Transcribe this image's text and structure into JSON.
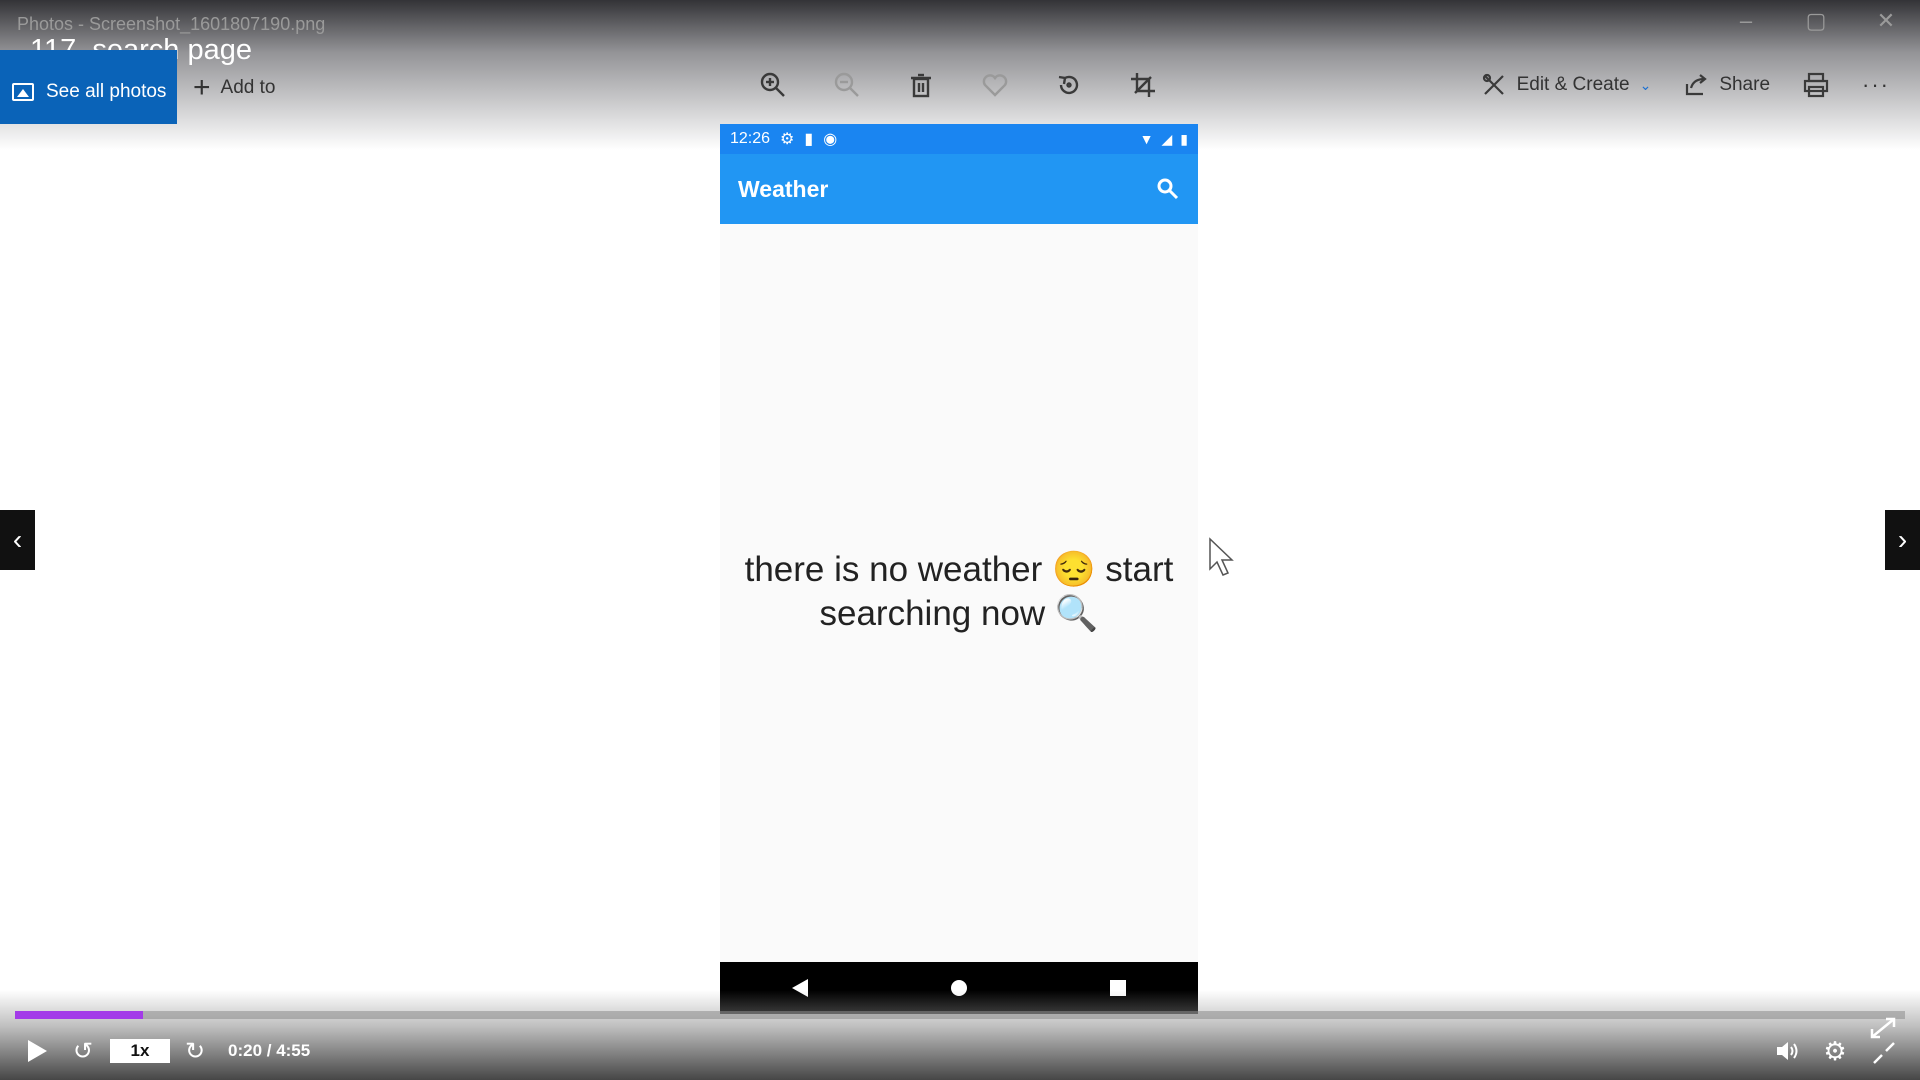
{
  "window": {
    "app_title": "Photos - Screenshot_1601807190.png"
  },
  "video": {
    "title": "117. search page",
    "speed": "1x",
    "time": "0:20 / 4:55",
    "progress": 0.0678
  },
  "toolbar": {
    "see_all_label": "See all photos",
    "add_to_label": "Add to",
    "edit_create_label": "Edit & Create",
    "share_label": "Share"
  },
  "phone": {
    "status_time": "12:26",
    "app_title": "Weather",
    "empty_line1": "there is no weather 😔 start",
    "empty_line2": "searching now 🔍"
  },
  "colors": {
    "accent_blue": "#2196f3",
    "status_blue": "#1a85f1",
    "see_all_bg": "#0a63b8",
    "progress": "#a33be8"
  }
}
